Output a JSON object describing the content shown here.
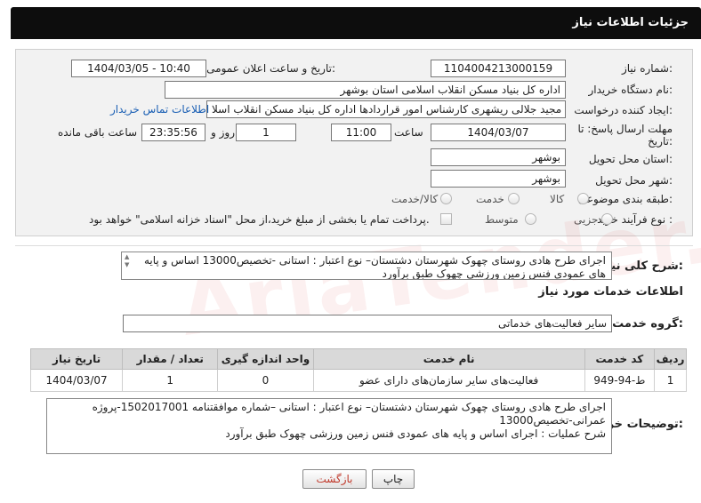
{
  "header": {
    "title": "جزئیات اطلاعات نیاز"
  },
  "form": {
    "need_number_label": "شماره نیاز:",
    "need_number": "1104004213000159",
    "announce_label": "تاریخ و ساعت اعلان عمومی:",
    "announce_value": "1404/03/05 - 10:40",
    "buyer_label": "نام دستگاه خریدار:",
    "buyer_value": "اداره کل بنیاد مسکن انقلاب اسلامی استان بوشهر",
    "creator_label": "ایجاد کننده درخواست:",
    "creator_value": "مجید جلالی ریشهری کارشناس امور قراردادها اداره کل بنیاد مسکن انقلاب اسلا",
    "contact_link": "اطلاعات تماس خریدار",
    "deadline_label_1": "مهلت ارسال پاسخ: تا",
    "deadline_label_2": "تاریخ:",
    "deadline_date": "1404/03/07",
    "time_label": "ساعت",
    "deadline_time": "11:00",
    "days_value": "1",
    "days_label": "روز و",
    "remaining_time": "23:35:56",
    "remaining_label": "ساعت باقی مانده",
    "province_label": "استان محل تحویل:",
    "province_value": "بوشهر",
    "city_label": "شهر محل تحویل:",
    "city_value": "بوشهر",
    "category_label": "طبقه بندی موضوعی:",
    "category_options": [
      "کالا",
      "خدمت",
      "کالا/خدمت"
    ],
    "process_label": "نوع فرآیند خرید :",
    "process_options": [
      "جزیی",
      "متوسط"
    ],
    "payment_note": "پرداخت تمام یا بخشی از مبلغ خرید،از محل \"اسناد خزانه اسلامی\" خواهد بود."
  },
  "summary": {
    "label": "شرح کلی نیاز:",
    "text": "اجرای طرح هادی روستای چهوک شهرستان دشتستان– نوع اعتبار : استانی -تخصیص13000 اساس و پایه های عمودی فنس زمین ورزشی چهوک طبق برآورد"
  },
  "services": {
    "section_title": "اطلاعات خدمات مورد نیاز",
    "group_label": "گروه خدمت:",
    "group_value": "سایر فعالیت‌های خدماتی",
    "columns": [
      "ردیف",
      "کد خدمت",
      "نام خدمت",
      "واحد اندازه گیری",
      "تعداد / مقدار",
      "تاریخ نیاز"
    ],
    "rows": [
      [
        "1",
        "ط-94-949",
        "فعالیت‌های سایر سازمان‌های دارای عضو",
        "0",
        "1",
        "1404/03/07"
      ]
    ]
  },
  "buyer_notes": {
    "label": "توضیحات خریدار:",
    "line1": "اجرای طرح هادی روستای چهوک شهرستان دشتستان– نوع اعتبار : استانی –شماره موافقتنامه 1502017001-پروژه",
    "line2": "عمرانی-تخصیص13000",
    "line3": "شرح عملیات : اجرای اساس و پایه های عمودی فنس زمین ورزشی چهوک طبق برآورد"
  },
  "buttons": {
    "print": "چاپ",
    "back": "بازگشت"
  }
}
